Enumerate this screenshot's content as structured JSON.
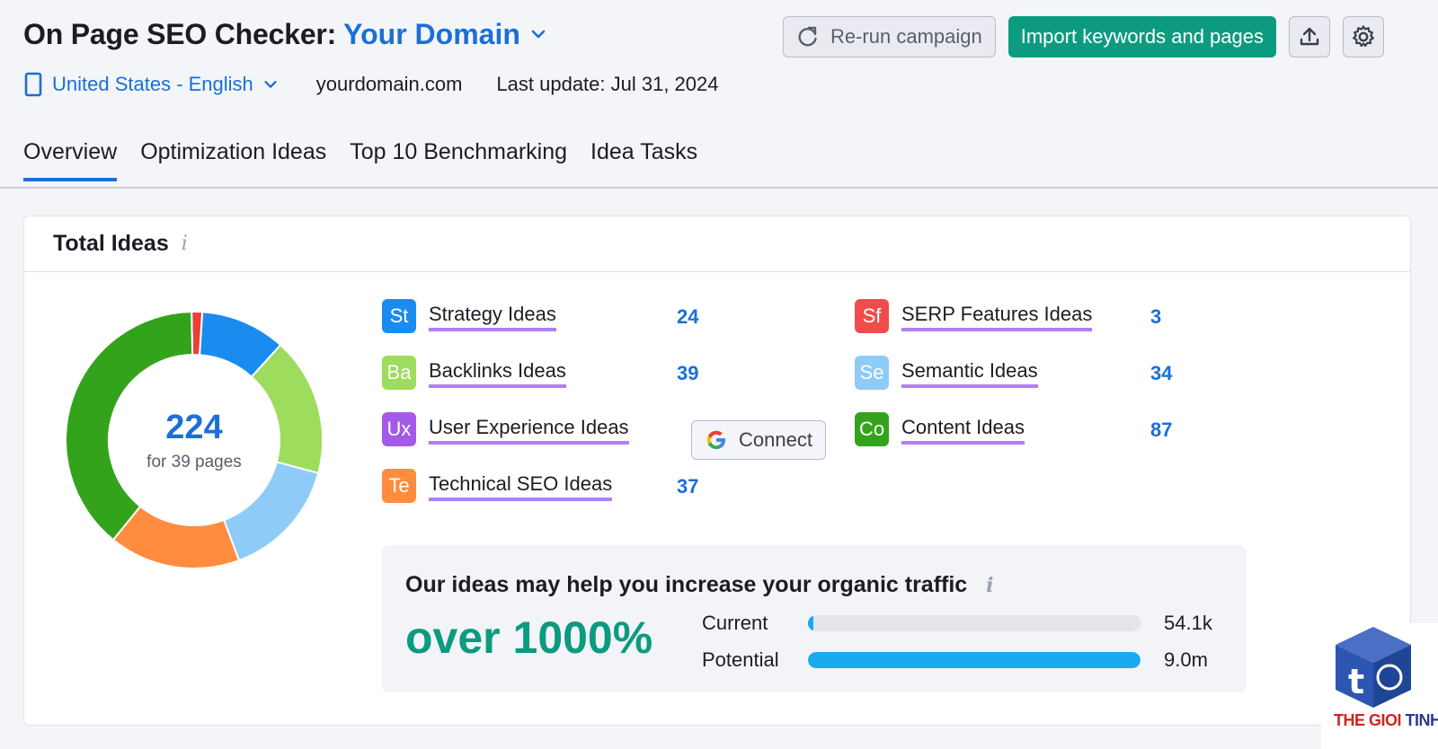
{
  "header": {
    "title": "On Page SEO Checker:",
    "domain": "Your Domain",
    "rerun_label": "Re-run campaign",
    "import_label": "Import keywords and pages",
    "locale": "United States - English",
    "site": "yourdomain.com",
    "last_update": "Last update: Jul 31, 2024"
  },
  "tabs": [
    {
      "label": "Overview",
      "active": true
    },
    {
      "label": "Optimization Ideas"
    },
    {
      "label": "Top 10 Benchmarking"
    },
    {
      "label": "Idea Tasks"
    }
  ],
  "card": {
    "title": "Total Ideas",
    "info": "i",
    "total": "224",
    "total_sub": "for 39 pages"
  },
  "ideas": [
    {
      "badge": "St",
      "label": "Strategy Ideas",
      "count": "24",
      "color": "#1a8cf0"
    },
    {
      "badge": "Ba",
      "label": "Backlinks Ideas",
      "count": "39",
      "color": "#9ddc5c"
    },
    {
      "badge": "Ux",
      "label": "User Experience Ideas",
      "count": "",
      "color": "#a35ae8"
    },
    {
      "badge": "Te",
      "label": "Technical SEO Ideas",
      "count": "37",
      "color": "#ff8c3f"
    },
    {
      "badge": "Sf",
      "label": "SERP Features Ideas",
      "count": "3",
      "color": "#f04c4c"
    },
    {
      "badge": "Se",
      "label": "Semantic Ideas",
      "count": "34",
      "color": "#8fcbf7"
    },
    {
      "badge": "Co",
      "label": "Content Ideas",
      "count": "87",
      "color": "#34a31c"
    }
  ],
  "connect_label": "Connect",
  "chart_data": {
    "type": "pie",
    "categories": [
      "SERP Features Ideas",
      "Strategy Ideas",
      "Backlinks Ideas",
      "Semantic Ideas",
      "Technical SEO Ideas",
      "Content Ideas"
    ],
    "values": [
      3,
      24,
      39,
      34,
      37,
      87
    ],
    "colors": [
      "#e8403b",
      "#1a8cf0",
      "#9ddc5c",
      "#8fcbf7",
      "#ff8c3f",
      "#34a31c"
    ]
  },
  "traffic": {
    "title": "Our ideas may help you increase your organic traffic",
    "info": "i",
    "big_text": "over 1000%",
    "rows": [
      {
        "label": "Current",
        "value": "54.1k",
        "fill": 0.01,
        "color": "#1aaaf0"
      },
      {
        "label": "Potential",
        "value": "9.0m",
        "fill": 1.0,
        "color": "#1aaaf0"
      }
    ]
  },
  "watermark": {
    "brand_a": "THE GIOI ",
    "brand_b": "TINHOC"
  }
}
